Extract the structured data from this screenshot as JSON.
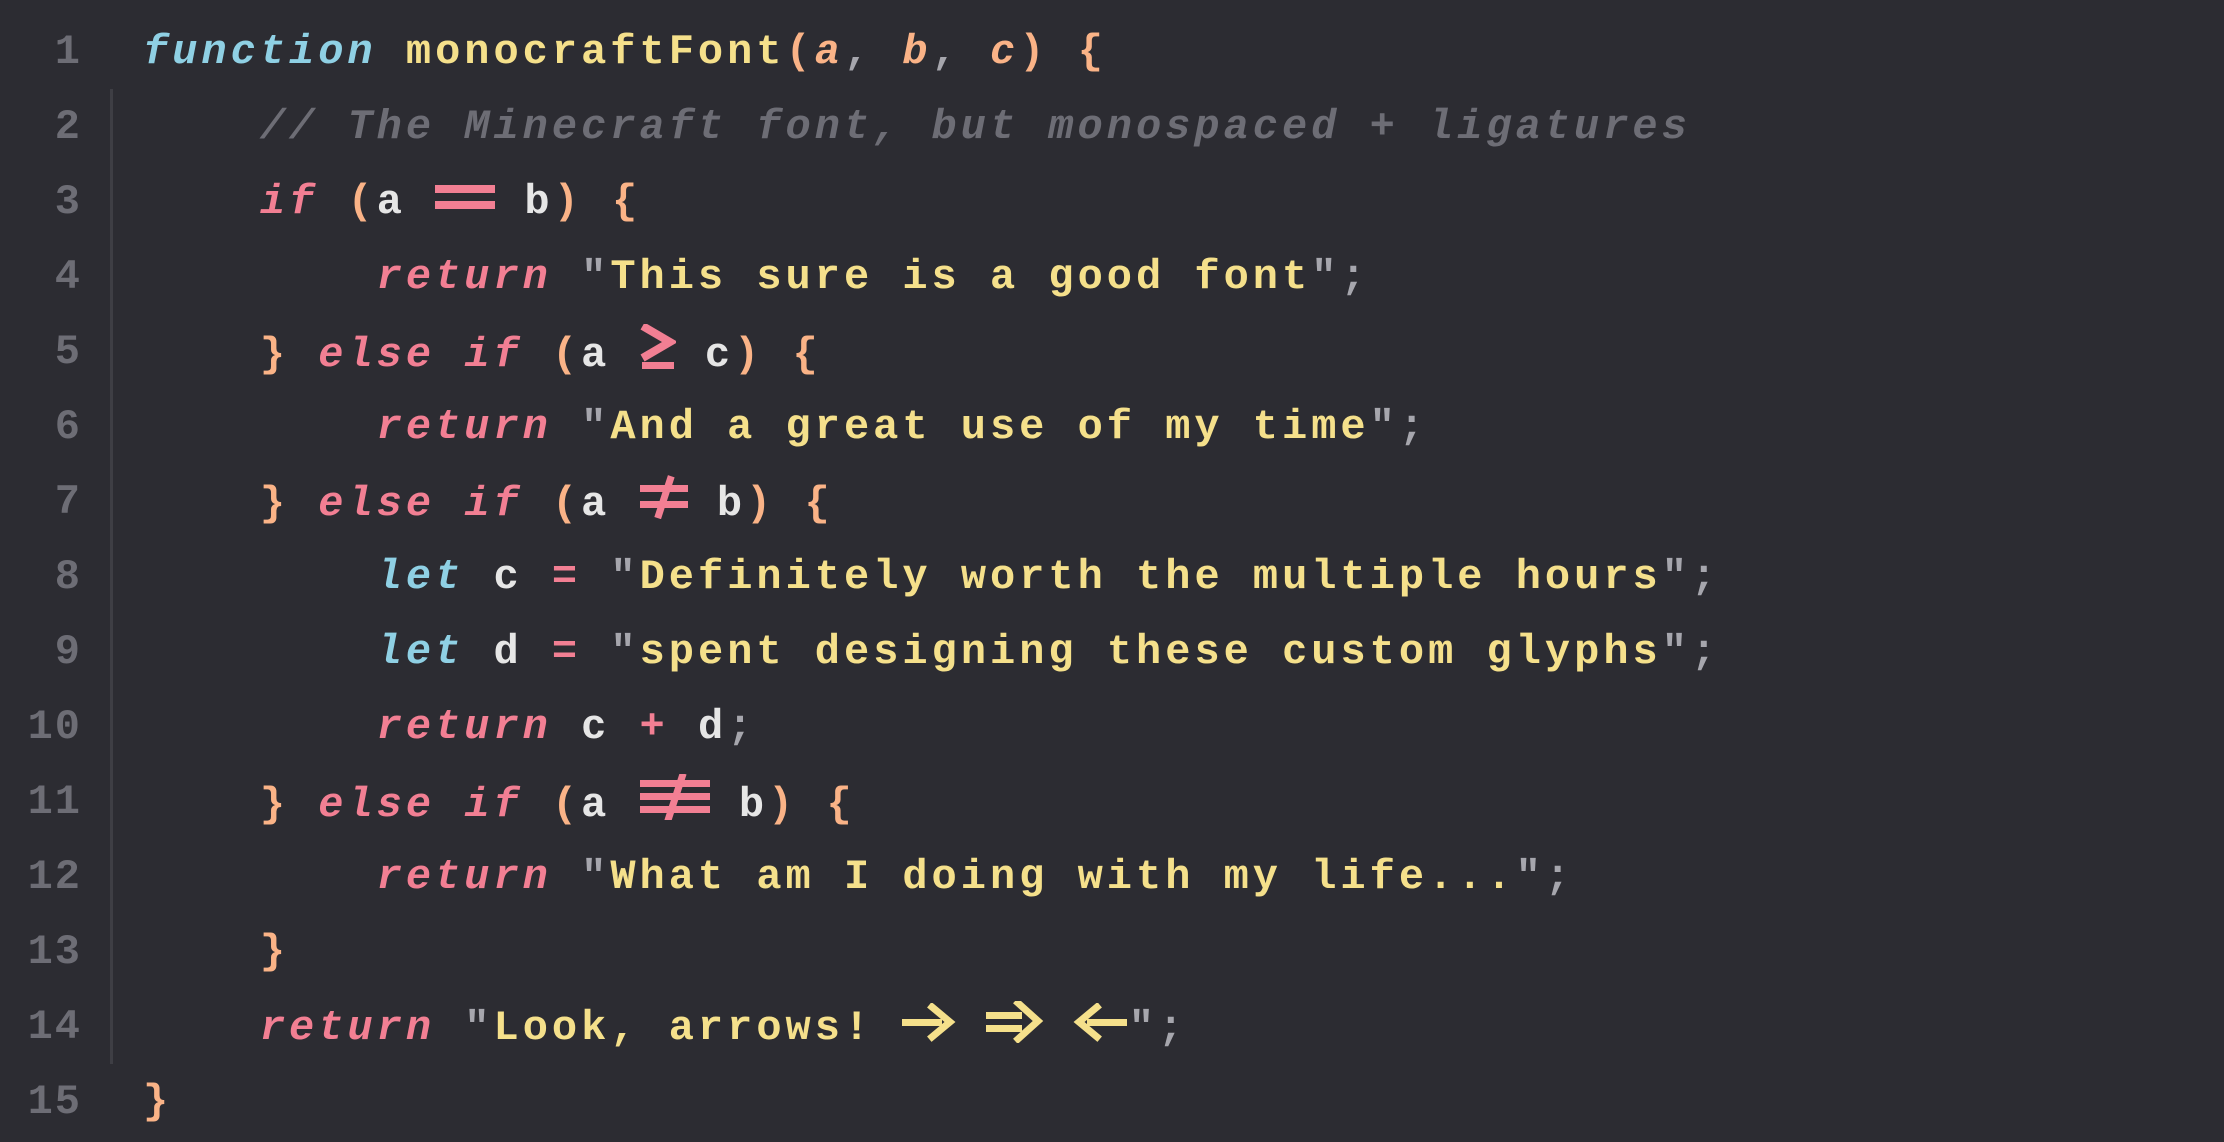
{
  "colors": {
    "background": "#2c2c32",
    "gutter": "#6d6d75",
    "indent_guide": "#3e3e44",
    "keyword_type": "#8fd0e4",
    "keyword_control": "#f27f93",
    "function_name": "#f5e08b",
    "parameter": "#fab387",
    "punctuation": "#a6a6ad",
    "brace": "#fab387",
    "operator": "#f27f93",
    "string": "#f5e08b",
    "comment": "#6d6d75",
    "identifier": "#e6e6e6"
  },
  "ln": {
    "l1": "1",
    "l2": "2",
    "l3": "3",
    "l4": "4",
    "l5": "5",
    "l6": "6",
    "l7": "7",
    "l8": "8",
    "l9": "9",
    "l10": "10",
    "l11": "11",
    "l12": "12",
    "l13": "13",
    "l14": "14",
    "l15": "15"
  },
  "kw": {
    "function": "function",
    "if": "if",
    "else": "else",
    "return": "return",
    "let": "let"
  },
  "sym": {
    "fn_name": "monocraftFont",
    "a": "a",
    "b": "b",
    "c": "c",
    "d": "d"
  },
  "p": {
    "lparen": "(",
    "rparen": ")",
    "lbrace": "{",
    "rbrace": "}",
    "comma": ",",
    "semi": ";",
    "eq": "=",
    "plus": "+",
    "q": "\""
  },
  "lig": {
    "eqeq": "==",
    "ge": ">=",
    "ne": "!=",
    "nee": "!==",
    "arrow": "->",
    "darrow": "=>",
    "larrow": "<-"
  },
  "str": {
    "s1": "This sure is a good font",
    "s2": "And a great use of my time",
    "s3": "Definitely worth the multiple hours",
    "s4": "spent designing these custom glyphs",
    "s5": "What am I doing with my life...",
    "s6a": "Look, arrows! ",
    "s6b": " "
  },
  "comment": {
    "c1": "// The Minecraft font, but monospaced + ligatures"
  }
}
